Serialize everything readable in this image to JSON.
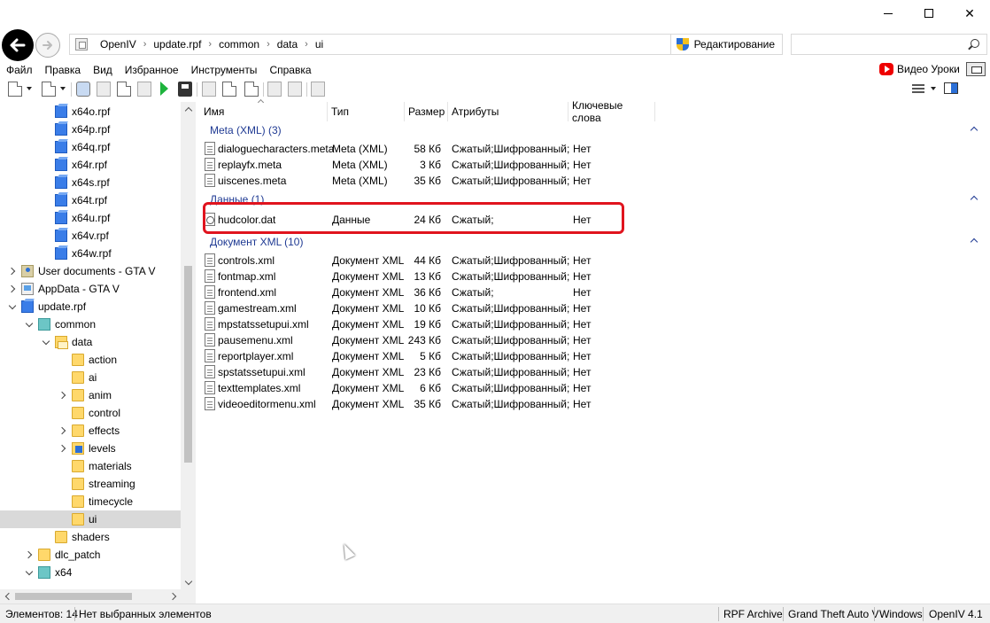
{
  "window": {
    "controls": [
      "minimize",
      "maximize",
      "close"
    ]
  },
  "address": {
    "crumbs": [
      "OpenIV",
      "update.rpf",
      "common",
      "data",
      "ui"
    ],
    "edit_mode_label": "Редактирование"
  },
  "search": {
    "value": "",
    "placeholder": ""
  },
  "menu": {
    "items": [
      "Файл",
      "Правка",
      "Вид",
      "Избранное",
      "Инструменты",
      "Справка"
    ],
    "video_lessons_label": "Видео Уроки"
  },
  "tree": {
    "rows": [
      {
        "label": "x64o.rpf",
        "icon": "rpf-archive-icon",
        "indent": 2,
        "expander": "none"
      },
      {
        "label": "x64p.rpf",
        "icon": "rpf-archive-icon",
        "indent": 2,
        "expander": "none"
      },
      {
        "label": "x64q.rpf",
        "icon": "rpf-archive-icon",
        "indent": 2,
        "expander": "none"
      },
      {
        "label": "x64r.rpf",
        "icon": "rpf-archive-icon",
        "indent": 2,
        "expander": "none"
      },
      {
        "label": "x64s.rpf",
        "icon": "rpf-archive-icon",
        "indent": 2,
        "expander": "none"
      },
      {
        "label": "x64t.rpf",
        "icon": "rpf-archive-icon",
        "indent": 2,
        "expander": "none"
      },
      {
        "label": "x64u.rpf",
        "icon": "rpf-archive-icon",
        "indent": 2,
        "expander": "none"
      },
      {
        "label": "x64v.rpf",
        "icon": "rpf-archive-icon",
        "indent": 2,
        "expander": "none"
      },
      {
        "label": "x64w.rpf",
        "icon": "rpf-archive-icon",
        "indent": 2,
        "expander": "none"
      },
      {
        "label": "User documents - GTA V",
        "icon": "user-folder-icon",
        "indent": 0,
        "expander": "collapsed"
      },
      {
        "label": "AppData - GTA V",
        "icon": "appdata-folder-icon",
        "indent": 0,
        "expander": "collapsed"
      },
      {
        "label": "update.rpf",
        "icon": "rpf-archive-icon",
        "indent": 0,
        "expander": "expanded"
      },
      {
        "label": "common",
        "icon": "teal-folder-icon",
        "indent": 1,
        "expander": "expanded"
      },
      {
        "label": "data",
        "icon": "open-folder-icon",
        "indent": 2,
        "expander": "expanded"
      },
      {
        "label": "action",
        "icon": "folder-icon",
        "indent": 3,
        "expander": "none"
      },
      {
        "label": "ai",
        "icon": "folder-icon",
        "indent": 3,
        "expander": "none"
      },
      {
        "label": "anim",
        "icon": "folder-icon",
        "indent": 3,
        "expander": "collapsed"
      },
      {
        "label": "control",
        "icon": "folder-icon",
        "indent": 3,
        "expander": "none"
      },
      {
        "label": "effects",
        "icon": "folder-icon",
        "indent": 3,
        "expander": "collapsed"
      },
      {
        "label": "levels",
        "icon": "levels-folder-icon",
        "indent": 3,
        "expander": "collapsed"
      },
      {
        "label": "materials",
        "icon": "folder-icon",
        "indent": 3,
        "expander": "none"
      },
      {
        "label": "streaming",
        "icon": "folder-icon",
        "indent": 3,
        "expander": "none"
      },
      {
        "label": "timecycle",
        "icon": "folder-icon",
        "indent": 3,
        "expander": "none"
      },
      {
        "label": "ui",
        "icon": "folder-icon",
        "indent": 3,
        "expander": "none",
        "selected": true
      },
      {
        "label": "shaders",
        "icon": "folder-icon",
        "indent": 2,
        "expander": "none"
      },
      {
        "label": "dlc_patch",
        "icon": "folder-icon",
        "indent": 1,
        "expander": "collapsed"
      },
      {
        "label": "x64",
        "icon": "teal-folder-icon",
        "indent": 1,
        "expander": "expanded"
      }
    ]
  },
  "list": {
    "columns": [
      "Имя",
      "Тип",
      "Размер",
      "Атрибуты",
      "Ключевые слова"
    ],
    "groups": [
      {
        "label": "Meta (XML) (3)",
        "files": [
          {
            "name": "dialoguecharacters.meta",
            "type": "Meta (XML)",
            "size": "58 Кб",
            "attributes": "Сжатый;Шифрованный;",
            "keywords": "Нет"
          },
          {
            "name": "replayfx.meta",
            "type": "Meta (XML)",
            "size": "3 Кб",
            "attributes": "Сжатый;Шифрованный;",
            "keywords": "Нет"
          },
          {
            "name": "uiscenes.meta",
            "type": "Meta (XML)",
            "size": "35 Кб",
            "attributes": "Сжатый;Шифрованный;",
            "keywords": "Нет"
          }
        ]
      },
      {
        "label": "Данные (1)",
        "files": [
          {
            "name": "hudcolor.dat",
            "type": "Данные",
            "size": "24 Кб",
            "attributes": "Сжатый;",
            "keywords": "Нет",
            "highlighted": true
          }
        ]
      },
      {
        "label": "Документ XML (10)",
        "files": [
          {
            "name": "controls.xml",
            "type": "Документ XML",
            "size": "44 Кб",
            "attributes": "Сжатый;Шифрованный;",
            "keywords": "Нет"
          },
          {
            "name": "fontmap.xml",
            "type": "Документ XML",
            "size": "13 Кб",
            "attributes": "Сжатый;Шифрованный;",
            "keywords": "Нет"
          },
          {
            "name": "frontend.xml",
            "type": "Документ XML",
            "size": "36 Кб",
            "attributes": "Сжатый;",
            "keywords": "Нет"
          },
          {
            "name": "gamestream.xml",
            "type": "Документ XML",
            "size": "10 Кб",
            "attributes": "Сжатый;Шифрованный;",
            "keywords": "Нет"
          },
          {
            "name": "mpstatssetupui.xml",
            "type": "Документ XML",
            "size": "19 Кб",
            "attributes": "Сжатый;Шифрованный;",
            "keywords": "Нет"
          },
          {
            "name": "pausemenu.xml",
            "type": "Документ XML",
            "size": "243 Кб",
            "attributes": "Сжатый;Шифрованный;",
            "keywords": "Нет"
          },
          {
            "name": "reportplayer.xml",
            "type": "Документ XML",
            "size": "5 Кб",
            "attributes": "Сжатый;Шифрованный;",
            "keywords": "Нет"
          },
          {
            "name": "spstatssetupui.xml",
            "type": "Документ XML",
            "size": "23 Кб",
            "attributes": "Сжатый;Шифрованный;",
            "keywords": "Нет"
          },
          {
            "name": "texttemplates.xml",
            "type": "Документ XML",
            "size": "6 Кб",
            "attributes": "Сжатый;Шифрованный;",
            "keywords": "Нет"
          },
          {
            "name": "videoeditormenu.xml",
            "type": "Документ XML",
            "size": "35 Кб",
            "attributes": "Сжатый;Шифрованный;",
            "keywords": "Нет"
          }
        ]
      }
    ]
  },
  "status": {
    "count_label": "Элементов: 14",
    "selection_label": "Нет выбранных элементов",
    "archive_type": "RPF Archive",
    "game": "Grand Theft Auto V",
    "platform": "Windows",
    "app_version": "OpenIV 4.1"
  },
  "colors": {
    "highlight_box": "#e0141e",
    "group_header": "#1f3a93",
    "selected_tree_row": "#d9d9d9"
  }
}
